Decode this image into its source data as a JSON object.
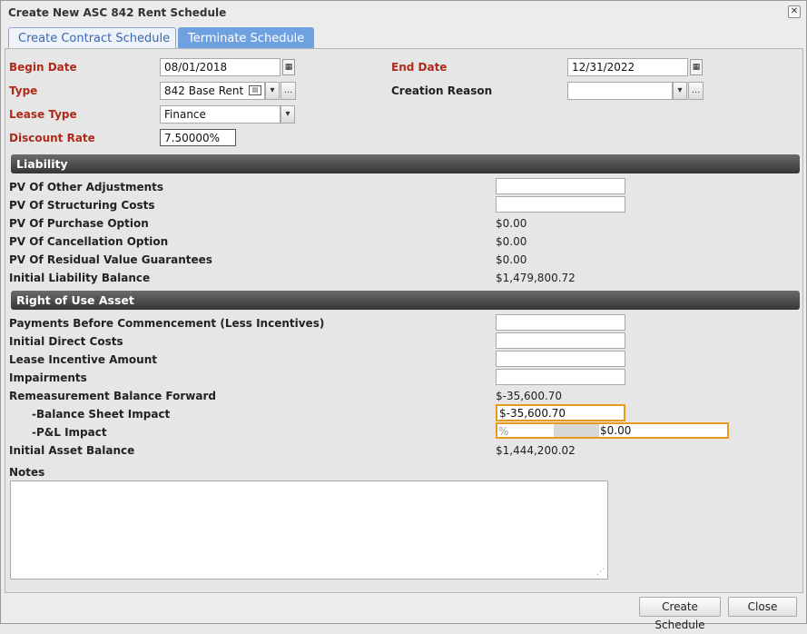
{
  "dialog": {
    "title": "Create New ASC 842 Rent Schedule",
    "close": "✕"
  },
  "tabs": [
    {
      "label": "Create Contract Schedule"
    },
    {
      "label": "Terminate Schedule"
    }
  ],
  "form": {
    "begin_date_label": "Begin Date",
    "begin_date_value": "08/01/2018",
    "end_date_label": "End Date",
    "end_date_value": "12/31/2022",
    "type_label": "Type",
    "type_value": "842 Base Rent",
    "creation_reason_label": "Creation Reason",
    "creation_reason_value": "",
    "lease_type_label": "Lease Type",
    "lease_type_value": "Finance",
    "discount_rate_label": "Discount Rate",
    "discount_rate_value": "7.50000%",
    "ellipsis": "..."
  },
  "liability": {
    "header": "Liability",
    "pv_other_adjustments": "PV Of Other Adjustments",
    "pv_structuring_costs": "PV Of Structuring Costs",
    "pv_purchase_option": "PV Of Purchase Option",
    "pv_purchase_option_value": "$0.00",
    "pv_cancellation_option": "PV Of Cancellation Option",
    "pv_cancellation_option_value": "$0.00",
    "pv_residual_value": "PV Of Residual Value Guarantees",
    "pv_residual_value_value": "$0.00",
    "initial_liability_balance": "Initial Liability Balance",
    "initial_liability_balance_value": "$1,479,800.72"
  },
  "rou": {
    "header": "Right of Use Asset",
    "payments_before": "Payments Before Commencement (Less Incentives)",
    "initial_direct_costs": "Initial Direct Costs",
    "lease_incentive": "Lease Incentive Amount",
    "impairments": "Impairments",
    "remeasurement": "Remeasurement Balance Forward",
    "remeasurement_value": "$-35,600.70",
    "balance_sheet_impact": "-Balance Sheet Impact",
    "balance_sheet_impact_value": "$-35,600.70",
    "pl_impact": "-P&L Impact",
    "pl_impact_percent": "%",
    "pl_impact_value": "$0.00",
    "initial_asset_balance": "Initial Asset Balance",
    "initial_asset_balance_value": "$1,444,200.02"
  },
  "notes": {
    "label": "Notes",
    "value": ""
  },
  "footer": {
    "create": "Create Schedule",
    "close": "Close"
  }
}
